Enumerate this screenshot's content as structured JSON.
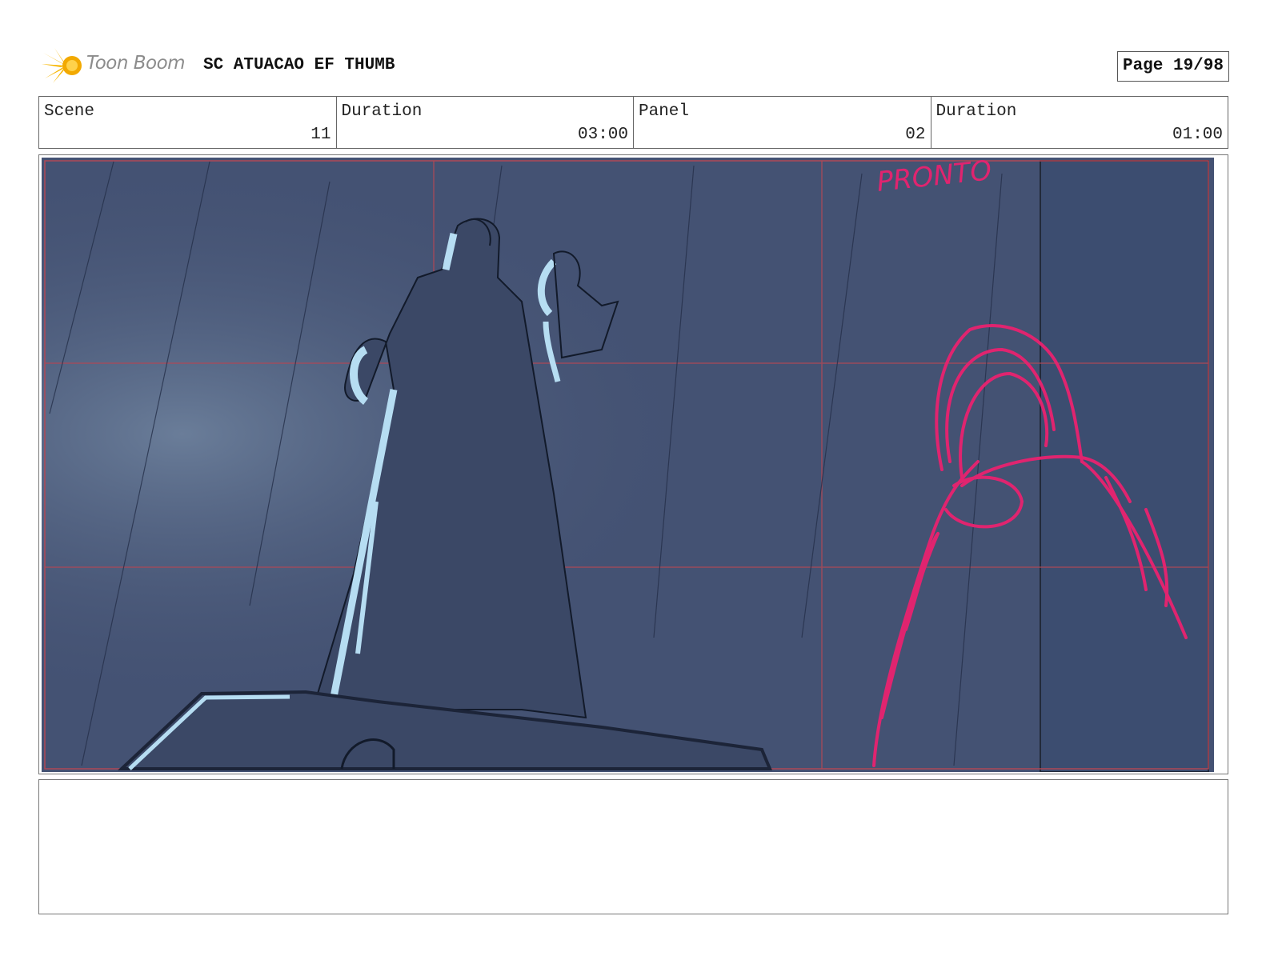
{
  "header": {
    "logo_text": "Toon Boom",
    "project_title": "SC ATUACAO EF THUMB",
    "page_label": "Page 19/98"
  },
  "info": {
    "scene_label": "Scene",
    "scene_value": "11",
    "scene_duration_label": "Duration",
    "scene_duration_value": "03:00",
    "panel_label": "Panel",
    "panel_value": "02",
    "panel_duration_label": "Duration",
    "panel_duration_value": "01:00"
  },
  "panel": {
    "annotation": "PRONTO",
    "colors": {
      "background": "#445273",
      "highlight": "#b6ddf2",
      "annotation": "#e0246f",
      "grid": "#c0404a"
    }
  },
  "notes": {
    "text": ""
  }
}
